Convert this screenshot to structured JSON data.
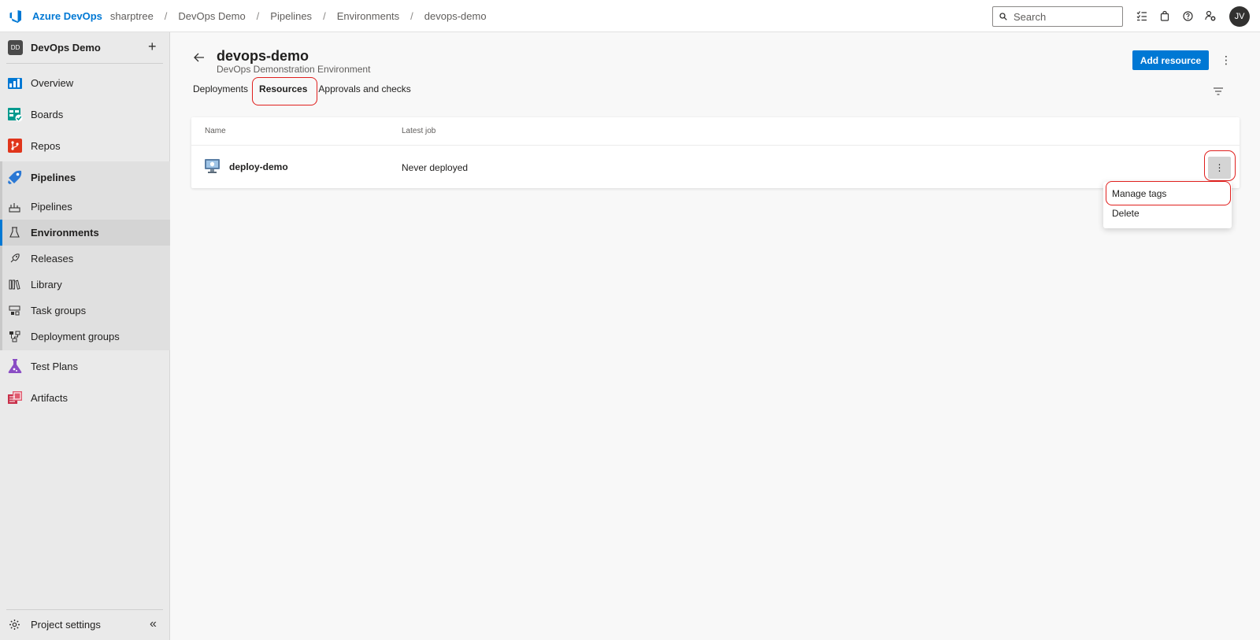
{
  "topbar": {
    "brand": "Azure DevOps",
    "breadcrumbs": [
      "sharptree",
      "DevOps Demo",
      "Pipelines",
      "Environments",
      "devops-demo"
    ],
    "search_placeholder": "Search",
    "avatar_initials": "JV",
    "icons": [
      "checklist-icon",
      "bag-icon",
      "help-icon",
      "user-settings-icon"
    ]
  },
  "sidebar": {
    "project_badge": "DD",
    "project_name": "DevOps Demo",
    "add_label": "+",
    "items": [
      {
        "label": "Overview",
        "icon": "overview-icon",
        "color": "#0078d4"
      },
      {
        "label": "Boards",
        "icon": "boards-icon",
        "color": "#009a8e"
      },
      {
        "label": "Repos",
        "icon": "repos-icon",
        "color": "#e0351b"
      },
      {
        "label": "Pipelines",
        "icon": "pipelines-icon",
        "color": "#2a78d4"
      }
    ],
    "pipeline_subitems": [
      {
        "label": "Pipelines",
        "icon": "pipelines-sub-icon"
      },
      {
        "label": "Environments",
        "icon": "environments-icon"
      },
      {
        "label": "Releases",
        "icon": "releases-icon"
      },
      {
        "label": "Library",
        "icon": "library-icon"
      },
      {
        "label": "Task groups",
        "icon": "task-groups-icon"
      },
      {
        "label": "Deployment groups",
        "icon": "deployment-groups-icon"
      }
    ],
    "bottom_items": [
      {
        "label": "Test Plans",
        "icon": "test-plans-icon",
        "color": "#8a4dc4"
      },
      {
        "label": "Artifacts",
        "icon": "artifacts-icon",
        "color": "#c8304a"
      }
    ],
    "settings_label": "Project settings",
    "collapse_label": "«"
  },
  "page": {
    "title": "devops-demo",
    "subtitle": "DevOps Demonstration Environment",
    "add_button": "Add resource",
    "more": "⋮",
    "tabs": [
      {
        "label": "Deployments",
        "active": false
      },
      {
        "label": "Resources",
        "active": true
      },
      {
        "label": "Approvals and checks",
        "active": false
      }
    ]
  },
  "table": {
    "columns": [
      "Name",
      "Latest job"
    ],
    "rows": [
      {
        "name": "deploy-demo",
        "latest_job": "Never deployed"
      }
    ],
    "row_more": "⋮"
  },
  "context_menu": {
    "items": [
      "Manage tags",
      "Delete"
    ]
  },
  "colors": {
    "accent": "#0078d4",
    "highlight": "#e0201e"
  }
}
